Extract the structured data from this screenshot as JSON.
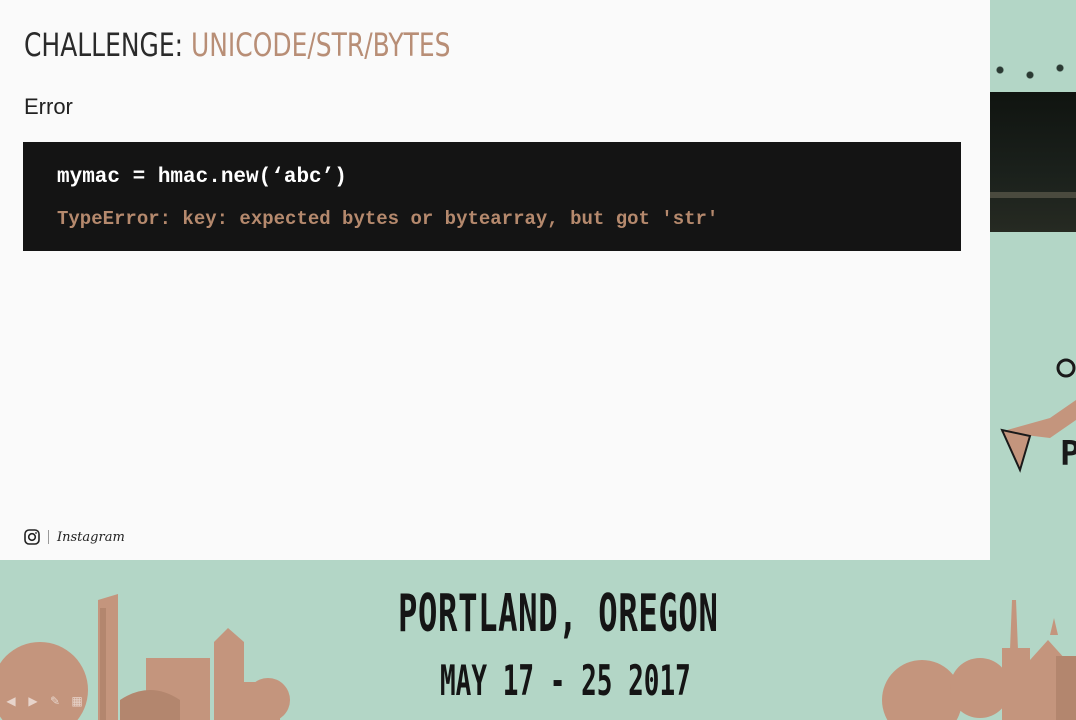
{
  "slide": {
    "title_prefix": "CHALLENGE:",
    "title_highlight": "UNICODE/STR/BYTES",
    "subtitle": "Error",
    "code": {
      "command": "mymac = hmac.new(‘abc’)",
      "error": "TypeError: key: expected bytes or bytearray, but got 'str'"
    },
    "footer": {
      "brand": "Instagram",
      "icon": "instagram-icon"
    }
  },
  "banner": {
    "city": "PORTLAND, OREGON",
    "dates": "MAY 17 - 25 2017"
  },
  "colors": {
    "accent": "#b88e76",
    "error_text": "#b5896d",
    "code_bg": "#141414",
    "banner_bg": "#b3d6c6",
    "building": "#c4957d"
  }
}
